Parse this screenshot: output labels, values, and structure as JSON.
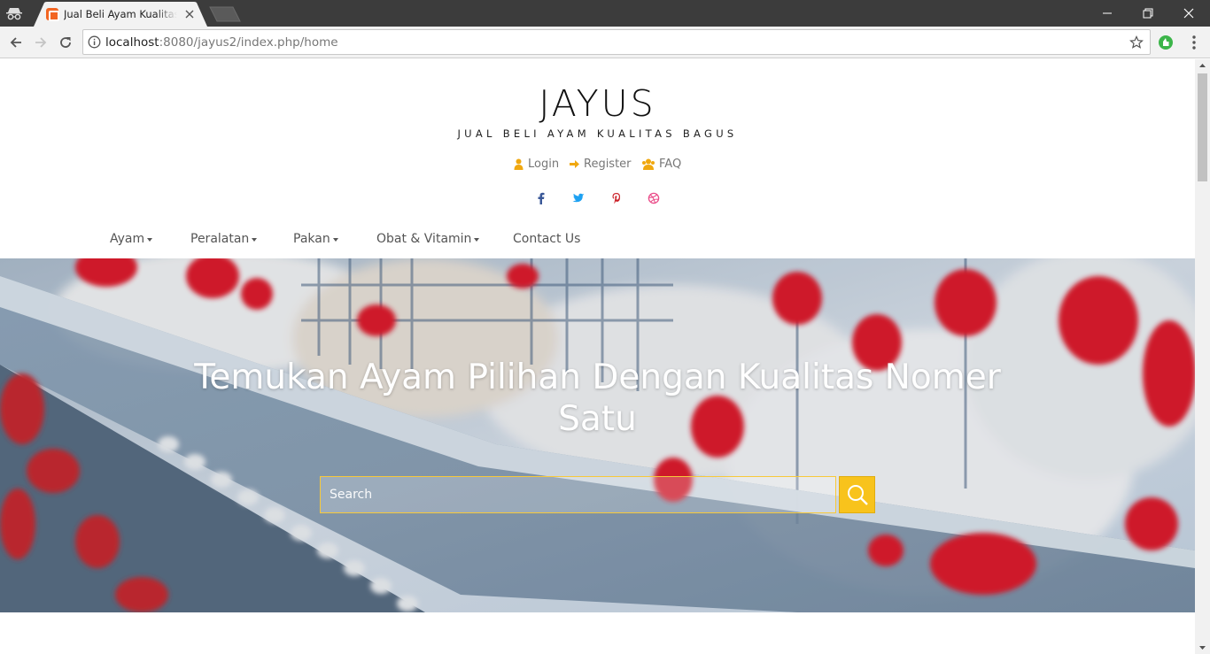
{
  "browser": {
    "tab_title": "Jual Beli Ayam Kualitas Bagus",
    "url_host": "localhost",
    "url_path": ":8080/jayus2/index.php/home"
  },
  "site": {
    "brand": "JAYUS",
    "tagline": "JUAL BELI AYAM KUALITAS BAGUS",
    "auth_links": [
      {
        "label": "Login",
        "icon": "user-icon"
      },
      {
        "label": "Register",
        "icon": "arrow-right-icon"
      },
      {
        "label": "FAQ",
        "icon": "users-icon"
      }
    ],
    "social": [
      "facebook-icon",
      "twitter-icon",
      "pinterest-icon",
      "dribbble-icon"
    ],
    "nav": [
      {
        "label": "Ayam",
        "dropdown": true
      },
      {
        "label": "Peralatan",
        "dropdown": true
      },
      {
        "label": "Pakan",
        "dropdown": true
      },
      {
        "label": "Obat & Vitamin",
        "dropdown": true
      },
      {
        "label": "Contact Us",
        "dropdown": false
      }
    ]
  },
  "hero": {
    "headline": "Temukan Ayam Pilihan Dengan Kualitas Nomer Satu",
    "search_placeholder": "Search"
  },
  "colors": {
    "accent": "#f8c31c",
    "icon_accent": "#f0a810",
    "facebook": "#3b5998",
    "twitter": "#1da1f2",
    "pinterest": "#cb2027",
    "dribbble": "#ea4c89"
  }
}
